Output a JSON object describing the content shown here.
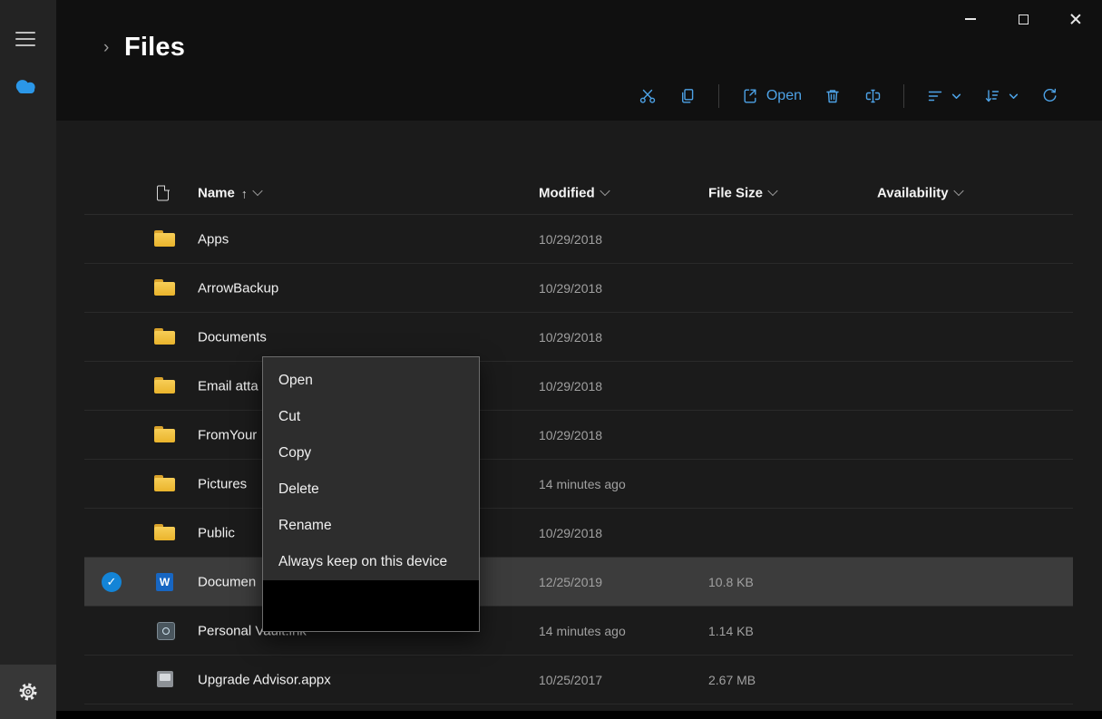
{
  "header": {
    "breadcrumb_chevron": "›",
    "title": "Files"
  },
  "toolbar": {
    "open_label": "Open"
  },
  "columns": {
    "name": "Name",
    "sort_arrow": "↑",
    "modified": "Modified",
    "file_size": "File Size",
    "availability": "Availability"
  },
  "rows": [
    {
      "name": "Apps",
      "type": "folder",
      "modified": "10/29/2018",
      "size": "",
      "availability": "",
      "selected": false
    },
    {
      "name": "ArrowBackup",
      "type": "folder",
      "modified": "10/29/2018",
      "size": "",
      "availability": "",
      "selected": false
    },
    {
      "name": "Documents",
      "type": "folder",
      "modified": "10/29/2018",
      "size": "",
      "availability": "",
      "selected": false
    },
    {
      "name": "Email atta",
      "type": "folder",
      "modified": "10/29/2018",
      "size": "",
      "availability": "",
      "selected": false
    },
    {
      "name": "FromYour",
      "type": "folder",
      "modified": "10/29/2018",
      "size": "",
      "availability": "",
      "selected": false
    },
    {
      "name": "Pictures",
      "type": "folder",
      "modified": "14 minutes ago",
      "size": "",
      "availability": "",
      "selected": false
    },
    {
      "name": "Public",
      "type": "folder",
      "modified": "10/29/2018",
      "size": "",
      "availability": "",
      "selected": false
    },
    {
      "name": "Documen",
      "type": "word-document",
      "modified": "12/25/2019",
      "size": "10.8 KB",
      "availability": "",
      "selected": true
    },
    {
      "name": "Personal Vault.lnk",
      "type": "vault-shortcut",
      "modified": "14 minutes ago",
      "size": "1.14 KB",
      "availability": "",
      "selected": false
    },
    {
      "name": "Upgrade Advisor.appx",
      "type": "appx-package",
      "modified": "10/25/2017",
      "size": "2.67 MB",
      "availability": "",
      "selected": false
    }
  ],
  "context_menu": {
    "items": [
      "Open",
      "Cut",
      "Copy",
      "Delete",
      "Rename",
      "Always keep on this device"
    ]
  }
}
